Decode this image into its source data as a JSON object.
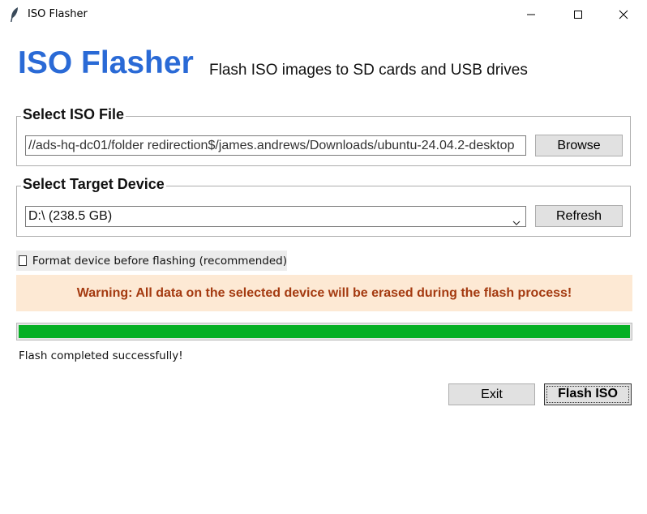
{
  "window": {
    "title": "ISO Flasher",
    "controls": {
      "minimize": "minimize-icon",
      "maximize": "maximize-icon",
      "close": "close-icon"
    }
  },
  "header": {
    "title": "ISO Flasher",
    "subtitle": "Flash ISO images to SD cards and USB drives"
  },
  "iso_section": {
    "label": "Select ISO File",
    "path_value": "//ads-hq-dc01/folder redirection$/james.andrews/Downloads/ubuntu-24.04.2-desktop",
    "browse_label": "Browse"
  },
  "device_section": {
    "label": "Select Target Device",
    "selected_device": "D:\\ (238.5 GB)",
    "refresh_label": "Refresh"
  },
  "format_option": {
    "label": "Format device before flashing (recommended)",
    "checked": false
  },
  "warning": {
    "text": "Warning: All data on the selected device will be erased during the flash process!"
  },
  "progress": {
    "percent": 100,
    "status": "Flash completed successfully!"
  },
  "actions": {
    "exit_label": "Exit",
    "flash_label": "Flash ISO"
  },
  "colors": {
    "accent": "#2a6ad6",
    "warning_bg": "#fde9d4",
    "warning_text": "#a43a10",
    "progress": "#06b025"
  }
}
